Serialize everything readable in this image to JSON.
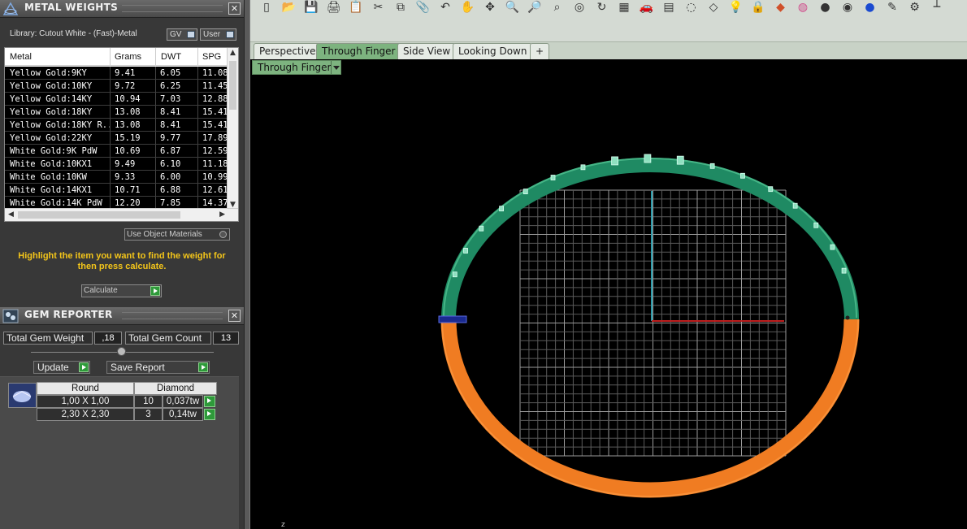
{
  "metal_panel": {
    "title": "METAL WEIGHTS",
    "library": "Library: Cutout White - (Fast)-Metal",
    "toggle_gv": "GV",
    "toggle_user": "User",
    "columns": [
      "Metal",
      "Grams",
      "DWT",
      "SPG"
    ],
    "rows": [
      [
        "Yellow Gold:9KY",
        "9.41",
        "6.05",
        "11.08"
      ],
      [
        "Yellow Gold:10KY",
        "9.72",
        "6.25",
        "11.45"
      ],
      [
        "Yellow Gold:14KY",
        "10.94",
        "7.03",
        "12.88"
      ],
      [
        "Yellow Gold:18KY",
        "13.08",
        "8.41",
        "15.41"
      ],
      [
        "Yellow Gold:18KY R...",
        "13.08",
        "8.41",
        "15.41"
      ],
      [
        "Yellow Gold:22KY",
        "15.19",
        "9.77",
        "17.89"
      ],
      [
        "White Gold:9K PdW",
        "10.69",
        "6.87",
        "12.59"
      ],
      [
        "White Gold:10KX1",
        "9.49",
        "6.10",
        "11.18"
      ],
      [
        "White Gold:10KW",
        "9.33",
        "6.00",
        "10.99"
      ],
      [
        "White Gold:14KX1",
        "10.71",
        "6.88",
        "12.61"
      ],
      [
        "White Gold:14K PdW",
        "12.20",
        "7.85",
        "14.37"
      ]
    ],
    "use_object_materials": "Use Object Materials",
    "hint": "Highlight the item you want to find the weight for then press calculate.",
    "calculate": "Calculate"
  },
  "gem_panel": {
    "title": "GEM REPORTER",
    "total_weight_label": "Total Gem Weight",
    "total_weight_value": ",18",
    "total_count_label": "Total Gem Count",
    "total_count_value": "13",
    "update": "Update",
    "save_report": "Save Report",
    "table_header": [
      "Round",
      "Diamond"
    ],
    "rows": [
      [
        "1,00 X 1,00",
        "10",
        "0,037tw"
      ],
      [
        "2,30 X 2,30",
        "3",
        "0,14tw"
      ]
    ]
  },
  "viewport": {
    "tabs": [
      "Perspective",
      "Through Finger",
      "Side View",
      "Looking Down"
    ],
    "active_tab": "Through Finger",
    "add_tab": "+",
    "view_dropdown": "Through Finger",
    "axis_mark": "z"
  },
  "toolbar_icons": [
    "new-icon",
    "open-icon",
    "save-icon",
    "print-icon",
    "paste-icon",
    "cut-icon",
    "copy-icon",
    "clipboard-icon",
    "undo-icon",
    "pan-hand-icon",
    "move-icon",
    "zoom-icon",
    "zoom-out-icon",
    "zoom-window-icon",
    "zoom-dynamic-icon",
    "rotate-view-icon",
    "four-views-icon",
    "car-icon",
    "grid-icon",
    "circle-select-icon",
    "gem-icon",
    "bulb-icon",
    "lock-icon",
    "layers-icon",
    "color-wheel-icon",
    "sphere-grey-icon",
    "sphere-shaded-icon",
    "sphere-blue-icon",
    "pencil-icon",
    "settings-gear-icon",
    "tree-icon"
  ],
  "colors": {
    "ring_green": "#1f8a63",
    "ring_orange": "#f07c22",
    "grid": "#8a8a8a",
    "axis_red": "#c02020",
    "axis_cyan": "#2a9aaa",
    "hint_yellow": "#f3c51a",
    "active_tab": "#7db37f"
  }
}
